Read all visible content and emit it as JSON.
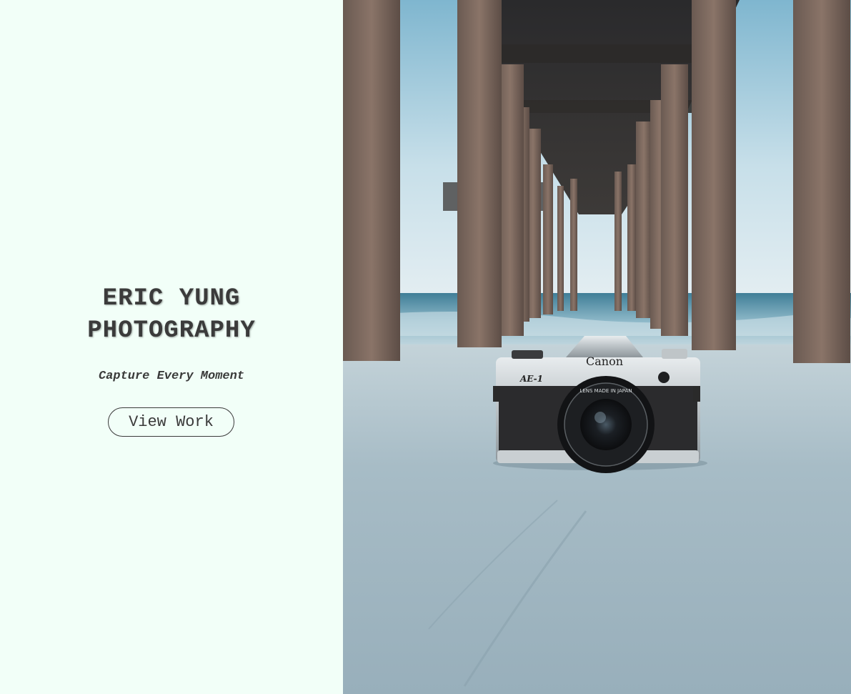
{
  "hero": {
    "title_line1": "ERIC YUNG",
    "title_line2": "PHOTOGRAPHY",
    "tagline": "Capture Every Moment",
    "cta_label": "View Work"
  },
  "photo": {
    "camera_brand": "Canon",
    "camera_model": "AE-1",
    "lens_text": "LENS MADE IN JAPAN"
  },
  "colors": {
    "panel_bg": "#f2fff8",
    "text": "#3a3a3a",
    "sky": "#b9d8e6",
    "sand": "#a9bcc6"
  }
}
